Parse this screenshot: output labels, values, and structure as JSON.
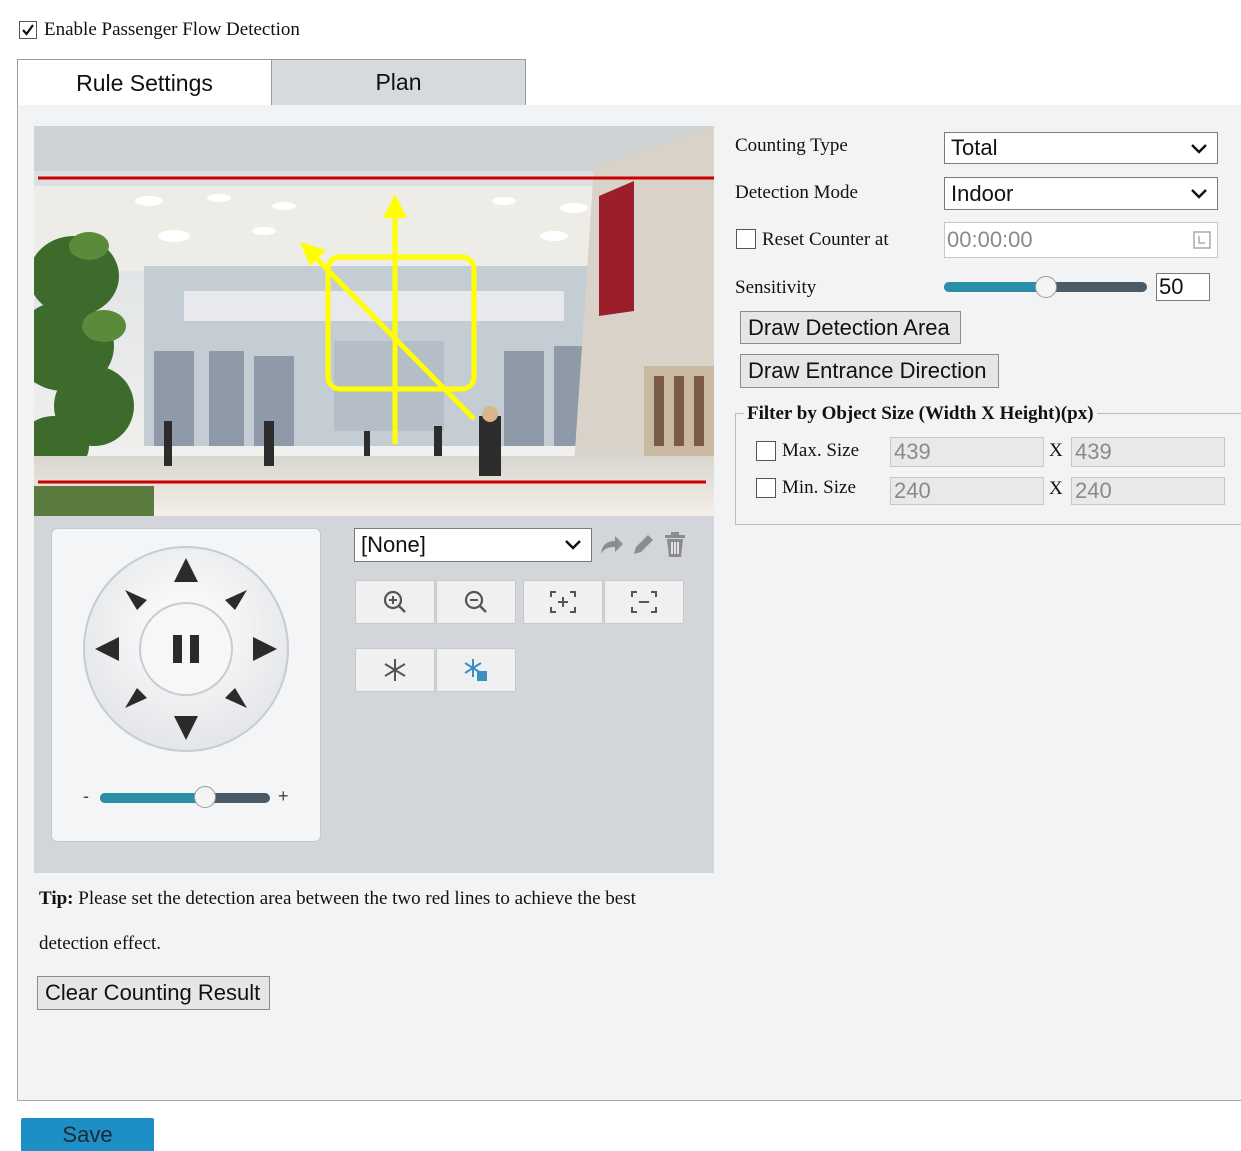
{
  "enable_detection": {
    "label": "Enable Passenger Flow Detection",
    "checked": true
  },
  "tabs": [
    {
      "label": "Rule Settings",
      "active": true
    },
    {
      "label": "Plan",
      "active": false
    }
  ],
  "settings": {
    "counting_type": {
      "label": "Counting Type",
      "value": "Total"
    },
    "detection_mode": {
      "label": "Detection Mode",
      "value": "Indoor"
    },
    "reset_counter": {
      "label": "Reset Counter at",
      "checked": false,
      "value": "00:00:00"
    },
    "sensitivity": {
      "label": "Sensitivity",
      "value": "50",
      "level": 0.5
    },
    "draw_area_label": "Draw Detection Area",
    "draw_direction_label": "Draw Entrance Direction",
    "filter": {
      "legend": "Filter by Object Size (Width X Height)(px)",
      "max": {
        "label": "Max. Size",
        "width": "439",
        "height": "439",
        "checked": false
      },
      "min": {
        "label": "Min. Size",
        "width": "240",
        "height": "240",
        "checked": false
      },
      "separator": "X"
    }
  },
  "ptz": {
    "preset_value": "[None]",
    "zoom_level": 0.62,
    "minus_label": "-",
    "plus_label": "+"
  },
  "tip": {
    "bold": "Tip:",
    "text_line1": "Please set the detection area between the two red lines to achieve the best",
    "text_line2": "detection effect."
  },
  "clear_label": "Clear Counting Result",
  "save_label": "Save",
  "colors": {
    "red_line": "#cc0000",
    "yellow": "#ffff00",
    "save_blue": "#1e8fc4",
    "slider_teal": "#2a8fa6"
  }
}
